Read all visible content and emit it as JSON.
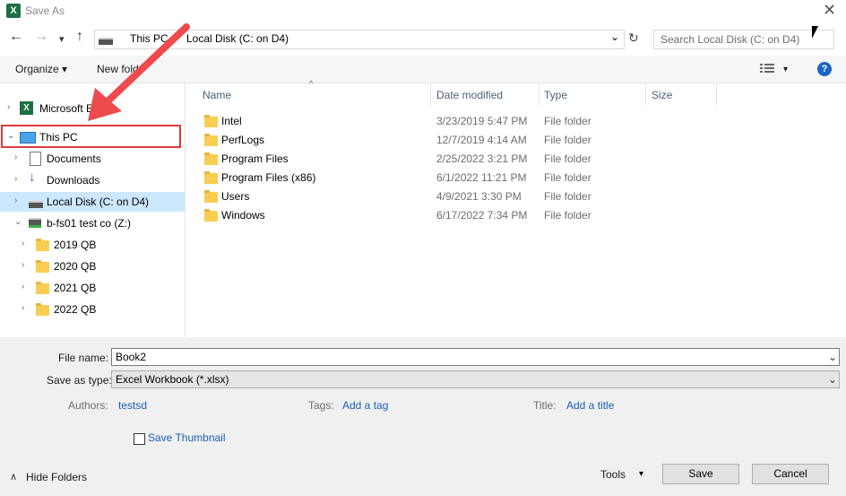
{
  "window": {
    "title": "Save As",
    "close_glyph": "✕",
    "app_icon_letter": "X"
  },
  "nav": {
    "back": "←",
    "forward": "→",
    "recent": "▾",
    "up": "↑",
    "refresh": "↻",
    "addr_dropdown": "⌄"
  },
  "address": {
    "crumbs": [
      "This PC",
      "Local Disk (C: on D4)"
    ],
    "separator": "›"
  },
  "search": {
    "placeholder": "Search Local Disk (C: on D4)"
  },
  "toolbar": {
    "organize": "Organize",
    "organize_caret": "▾",
    "new_folder": "New folder",
    "view_caret": "▾",
    "help": "?"
  },
  "sidebar": {
    "items": [
      {
        "label": "Microsoft E",
        "chev": "›"
      },
      {
        "label": "This PC",
        "chev": "⌄"
      },
      {
        "label": "Documents",
        "chev": "›"
      },
      {
        "label": "Downloads",
        "chev": "›"
      },
      {
        "label": "Local Disk (C: on D4)",
        "chev": "›"
      },
      {
        "label": "b-fs01 test co (Z:)",
        "chev": "⌄"
      },
      {
        "label": "2019 QB",
        "chev": "›"
      },
      {
        "label": "2020 QB",
        "chev": "›"
      },
      {
        "label": "2021 QB",
        "chev": "›"
      },
      {
        "label": "2022 QB",
        "chev": "›"
      }
    ]
  },
  "columns": {
    "name": "Name",
    "date": "Date modified",
    "type": "Type",
    "size": "Size",
    "sort_glyph": "^"
  },
  "files": [
    {
      "name": "Intel",
      "date": "3/23/2019 5:47 PM",
      "type": "File folder"
    },
    {
      "name": "PerfLogs",
      "date": "12/7/2019 4:14 AM",
      "type": "File folder"
    },
    {
      "name": "Program Files",
      "date": "2/25/2022 3:21 PM",
      "type": "File folder"
    },
    {
      "name": "Program Files (x86)",
      "date": "6/1/2022 11:21 PM",
      "type": "File folder"
    },
    {
      "name": "Users",
      "date": "4/9/2021 3:30 PM",
      "type": "File folder"
    },
    {
      "name": "Windows",
      "date": "6/17/2022 7:34 PM",
      "type": "File folder"
    }
  ],
  "form": {
    "file_name_label": "File name:",
    "file_name_value": "Book2",
    "save_type_label": "Save as type:",
    "save_type_value": "Excel Workbook (*.xlsx)",
    "dropdown_glyph": "⌄",
    "authors_label": "Authors:",
    "authors_value": "testsd",
    "tags_label": "Tags:",
    "tags_value": "Add a tag",
    "title_label": "Title:",
    "title_value": "Add a title",
    "thumbnail_label": "Save Thumbnail"
  },
  "footer": {
    "hide_folders": "Hide Folders",
    "hide_glyph": "∧",
    "tools": "Tools",
    "tools_caret": "▾",
    "save": "Save",
    "cancel": "Cancel"
  },
  "colors": {
    "accent": "#1a65c0",
    "selection": "#cce8ff",
    "annotation": "#e0393e",
    "folder": "#f7ce52"
  }
}
